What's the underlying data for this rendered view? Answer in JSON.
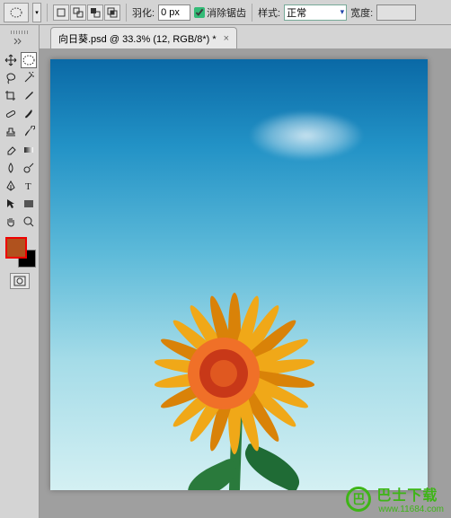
{
  "options_bar": {
    "feather_label": "羽化:",
    "feather_value": "0 px",
    "antialias_label": "消除锯齿",
    "antialias_checked": true,
    "style_label": "样式:",
    "style_value": "正常",
    "width_label": "宽度:"
  },
  "document": {
    "tab_title": "向日葵.psd @ 33.3% (12, RGB/8*) *",
    "close_symbol": "×"
  },
  "tools": {
    "items": [
      "move-tool",
      "marquee-tool",
      "lasso-tool",
      "quick-select-tool",
      "crop-tool",
      "eyedropper-tool",
      "spot-heal-tool",
      "brush-tool",
      "clone-stamp-tool",
      "history-brush-tool",
      "eraser-tool",
      "gradient-tool",
      "blur-tool",
      "dodge-tool",
      "pen-tool",
      "type-tool",
      "path-select-tool",
      "rectangle-shape-tool",
      "hand-tool",
      "zoom-tool"
    ],
    "selected": "marquee-tool"
  },
  "colors": {
    "foreground": "#b0521e",
    "background": "#000000"
  },
  "watermark": {
    "logo_text": "巴",
    "main": "巴士下载",
    "sub": "www.11684.com"
  }
}
